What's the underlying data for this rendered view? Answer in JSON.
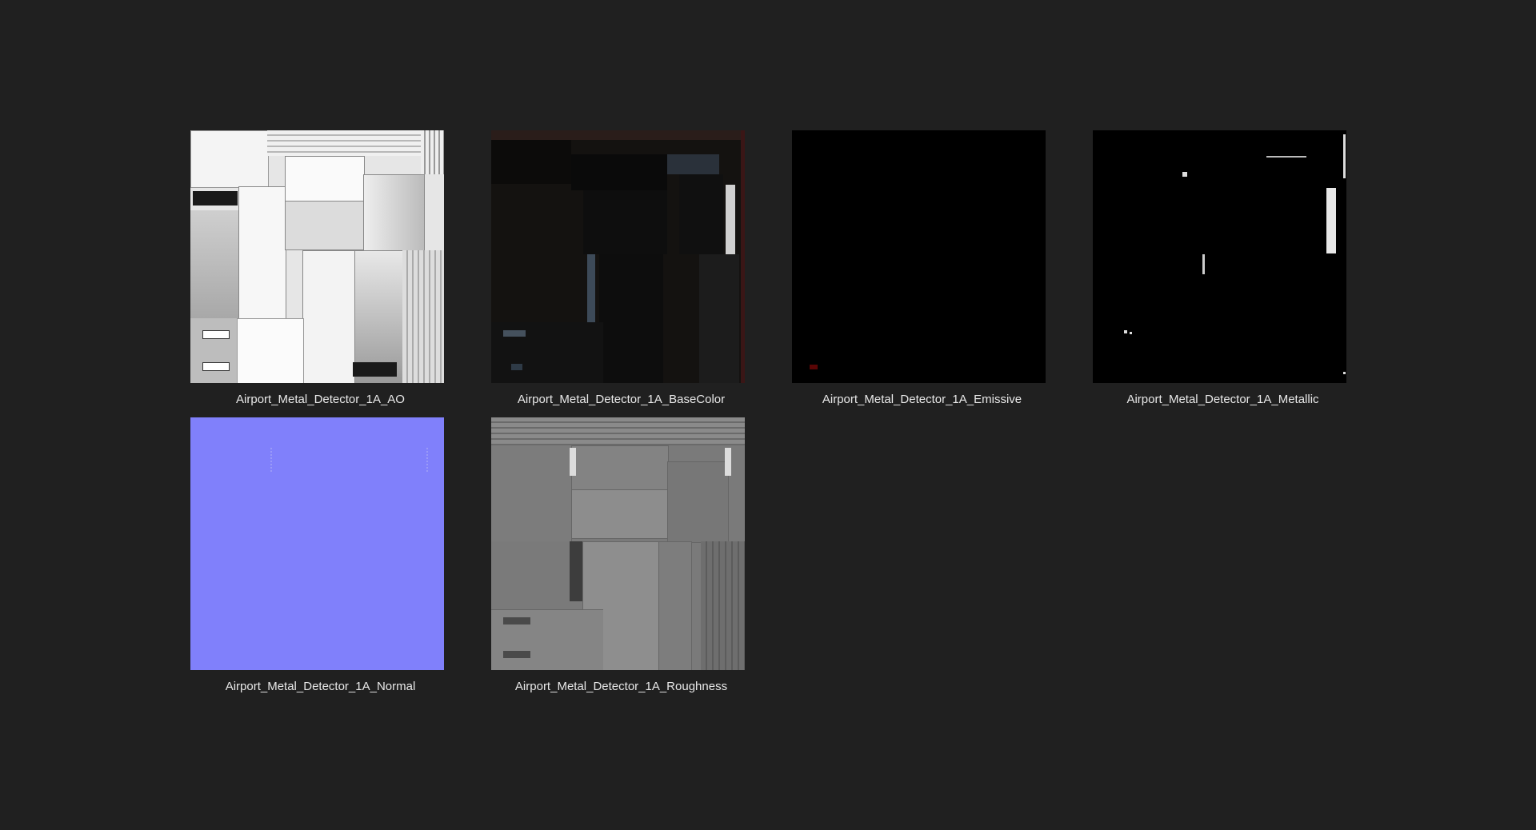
{
  "files": [
    {
      "name": "Airport_Metal_Detector_1A_AO",
      "map": "ao"
    },
    {
      "name": "Airport_Metal_Detector_1A_BaseColor",
      "map": "basecolor"
    },
    {
      "name": "Airport_Metal_Detector_1A_Emissive",
      "map": "emissive"
    },
    {
      "name": "Airport_Metal_Detector_1A_Metallic",
      "map": "metallic"
    },
    {
      "name": "Airport_Metal_Detector_1A_Normal",
      "map": "normal"
    },
    {
      "name": "Airport_Metal_Detector_1A_Roughness",
      "map": "roughness"
    }
  ],
  "colors": {
    "background": "#202020",
    "label_text": "#e8e8e8",
    "normal_map": "#8080fb"
  }
}
